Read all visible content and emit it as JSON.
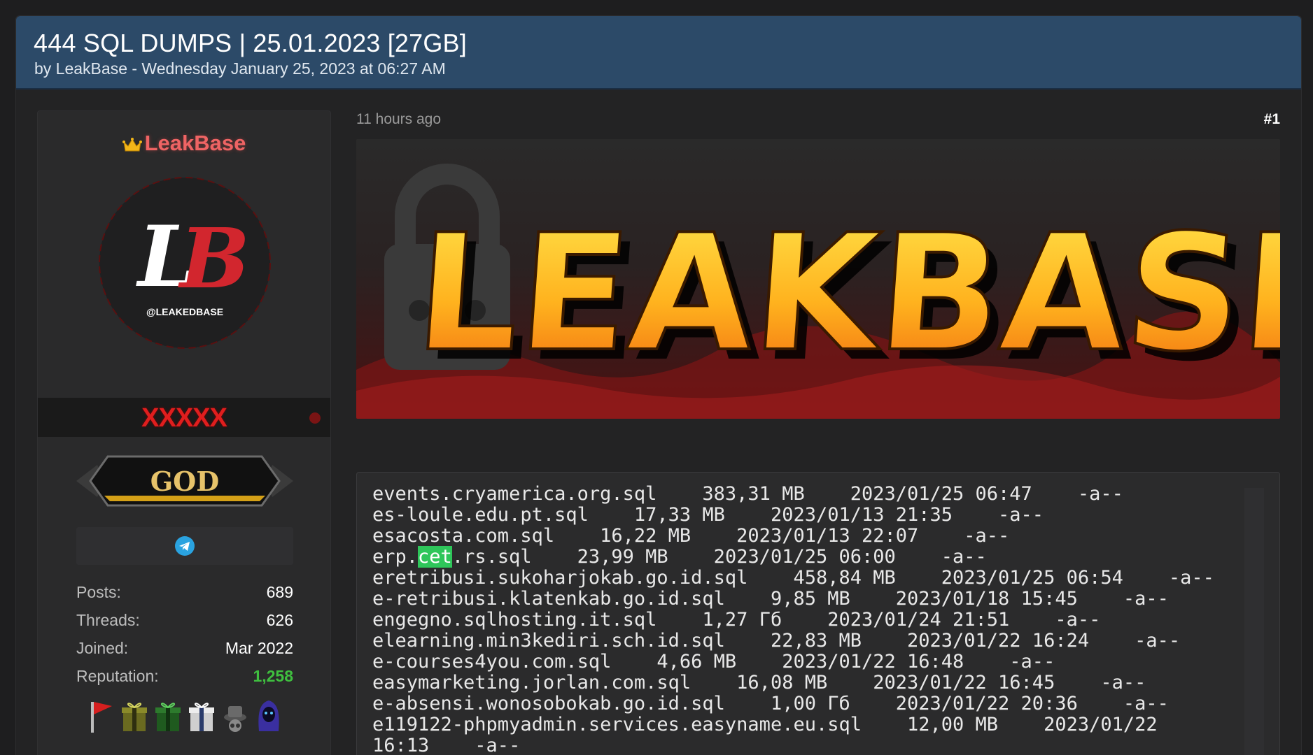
{
  "thread": {
    "title": "444 SQL DUMPS | 25.01.2023 [27GB]",
    "byline": "by LeakBase - Wednesday January 25, 2023 at 06:27 AM"
  },
  "user": {
    "name": "LeakBase",
    "avatar_text": "@LEAKEDBASE",
    "avatar_letters": "LB",
    "banner_text": "XXXXX",
    "rank": "GOD",
    "stats": [
      {
        "label": "Posts:",
        "value": "689"
      },
      {
        "label": "Threads:",
        "value": "626"
      },
      {
        "label": "Joined:",
        "value": "Mar 2022"
      },
      {
        "label": "Reputation:",
        "value": "1,258"
      }
    ]
  },
  "post": {
    "time": "11 hours ago",
    "number": "#1",
    "banner_text": "LEAKBASE",
    "code_lines": [
      {
        "pre": "events.cryamerica.org.sql    383,31 MB    2023/01/25 06:47    -a--"
      },
      {
        "pre": "es-loule.edu.pt.sql    17,33 MB    2023/01/13 21:35    -a--"
      },
      {
        "pre": "esacosta.com.sql    16,22 MB    2023/01/13 22:07    -a--"
      },
      {
        "pre": "erp.",
        "hl": "cet",
        "post": ".rs.sql    23,99 MB    2023/01/25 06:00    -a--"
      },
      {
        "pre": "eretribusi.sukoharjokab.go.id.sql    458,84 MB    2023/01/25 06:54    -a--"
      },
      {
        "pre": "e-retribusi.klatenkab.go.id.sql    9,85 MB    2023/01/18 15:45    -a--"
      },
      {
        "pre": "engegno.sqlhosting.it.sql    1,27 Гб    2023/01/24 21:51    -a--"
      },
      {
        "pre": "elearning.min3kediri.sch.id.sql    22,83 MB    2023/01/22 16:24    -a--"
      },
      {
        "pre": "e-courses4you.com.sql    4,66 MB    2023/01/22 16:48    -a--"
      },
      {
        "pre": "easymarketing.jorlan.com.sql    16,08 MB    2023/01/22 16:45    -a--"
      },
      {
        "pre": "e-absensi.wonosobokab.go.id.sql    1,00 Гб    2023/01/22 20:36    -a--"
      },
      {
        "pre": "e119122-phpmyadmin.services.easyname.eu.sql    12,00 MB    2023/01/22"
      },
      {
        "pre": "16:13    -a--"
      }
    ]
  },
  "colors": {
    "header_bg": "#2c4a68",
    "username": "#ef6464",
    "reputation": "#3fbf3f",
    "highlight": "#2ec65a"
  }
}
